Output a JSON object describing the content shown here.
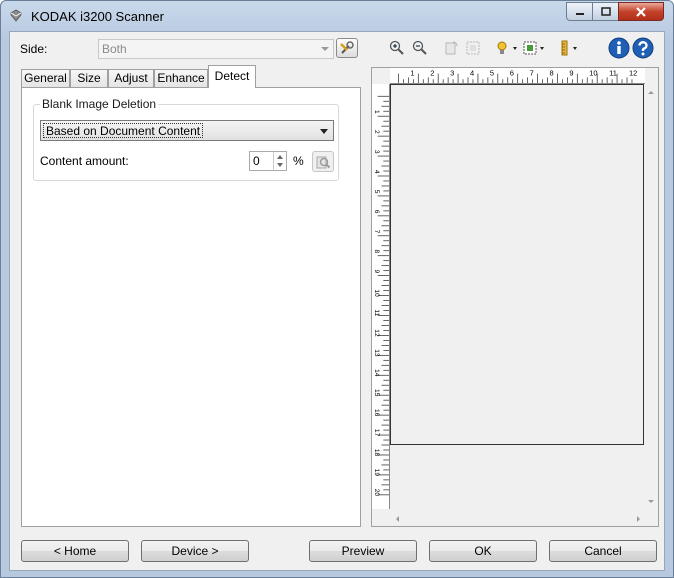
{
  "window": {
    "title": "KODAK i3200 Scanner",
    "controls": {
      "minimize_icon": "minimize-icon",
      "maximize_icon": "maximize-icon",
      "close_icon": "close-icon"
    }
  },
  "side": {
    "label": "Side:",
    "value": "Both"
  },
  "toolbar": {
    "icons": [
      "settings-shortcuts-icon",
      "zoom-in-icon",
      "zoom-out-icon",
      "rotate-icon",
      "outline-icon",
      "lamp-icon",
      "preview-mode-icon",
      "ruler-icon",
      "info-icon",
      "help-icon"
    ]
  },
  "tabs": [
    {
      "label": "General"
    },
    {
      "label": "Size"
    },
    {
      "label": "Adjust"
    },
    {
      "label": "Enhance"
    },
    {
      "label": "Detect"
    }
  ],
  "detect": {
    "group_title": "Blank Image Deletion",
    "mode": "Based on Document Content",
    "content_label": "Content amount:",
    "content_value": "0",
    "content_unit": "%"
  },
  "preview": {
    "ruler_h": [
      "1",
      "2",
      "3",
      "4",
      "5",
      "6",
      "7",
      "8",
      "9",
      "10",
      "11",
      "12"
    ],
    "ruler_v": [
      "1",
      "2",
      "3",
      "4",
      "5",
      "6",
      "7",
      "8",
      "9",
      "10",
      "11",
      "12",
      "13",
      "14",
      "15",
      "16",
      "17",
      "18",
      "19",
      "20"
    ]
  },
  "buttons": {
    "home": "< Home",
    "device": "Device >",
    "preview": "Preview",
    "ok": "OK",
    "cancel": "Cancel"
  },
  "colors": {
    "info": "#1f5fb5",
    "help": "#1f5fb5",
    "close": "#c4432b"
  }
}
